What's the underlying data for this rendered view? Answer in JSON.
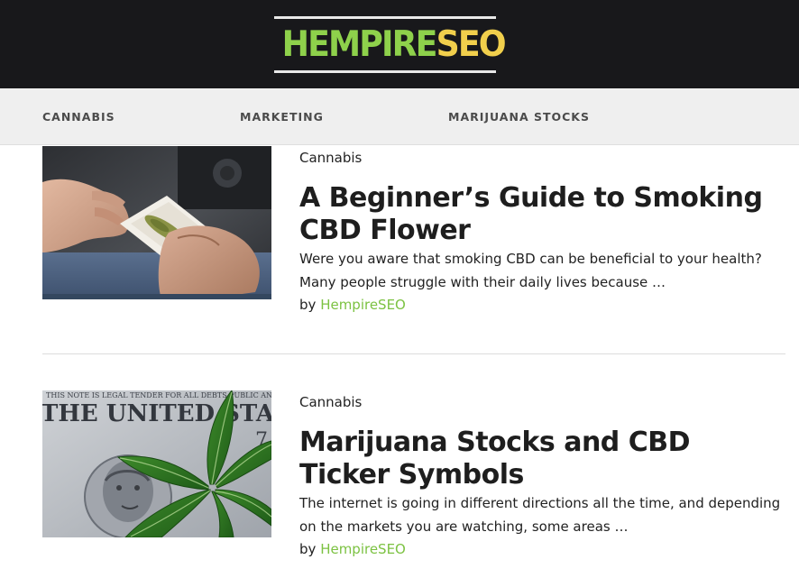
{
  "site": {
    "logo_part1": "HEMPIRE",
    "logo_part2": "SEO"
  },
  "nav": {
    "items": [
      "CANNABIS",
      "MARKETING",
      "MARIJUANA STOCKS"
    ]
  },
  "posts": [
    {
      "category": "Cannabis",
      "title": "A Beginner’s Guide to Smoking CBD Flower",
      "excerpt": "Were you aware that smoking CBD can be beneficial to your health? Many people struggle with their daily lives because …",
      "by_label": "by",
      "author": "HempireSEO"
    },
    {
      "category": "Cannabis",
      "title": "Marijuana Stocks and CBD Ticker Symbols",
      "excerpt": "The internet is going in different directions all the time, and depending on the markets you are watching, some areas …",
      "by_label": "by",
      "author": "HempireSEO",
      "thumb_banner_text": "THE UNITED STATES OF AMERICA",
      "thumb_small_text": "THIS NOTE IS LEGAL TENDER FOR ALL DEBTS PUBLIC AND PRIVATE"
    }
  ],
  "colors": {
    "header_bg": "#18181b",
    "nav_bg": "#efefef",
    "logo_green": "#8ed14b",
    "logo_yellow": "#f1cf4c",
    "author_link": "#7cc242"
  }
}
